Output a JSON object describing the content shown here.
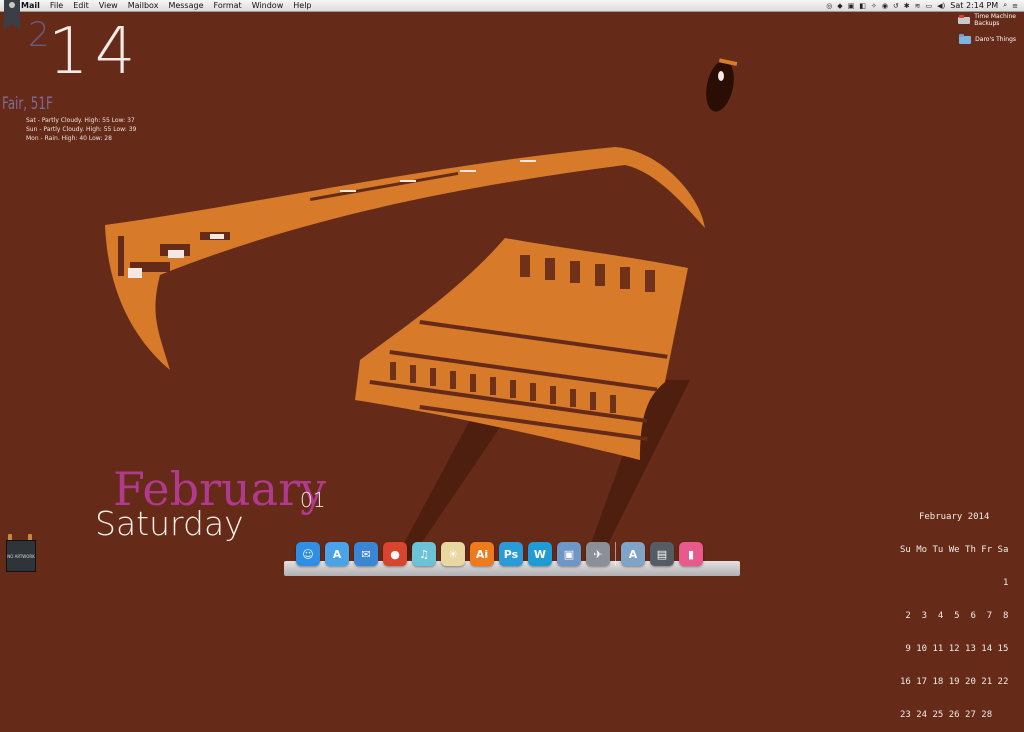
{
  "menubar": {
    "items": [
      "Mail",
      "File",
      "Edit",
      "View",
      "Mailbox",
      "Message",
      "Format",
      "Window",
      "Help"
    ],
    "clock": "Sat 2:14 PM"
  },
  "desktop_clock": {
    "hour_small": "2",
    "minutes": "14"
  },
  "weather": {
    "current": "Fair, 51F",
    "forecast": [
      "Sat - Partly Cloudy. High: 55 Low: 37",
      "Sun - Partly Cloudy. High: 55 Low: 39",
      "Mon - Rain. High: 40 Low: 28"
    ]
  },
  "date_widget": {
    "month": "February",
    "day": "01",
    "weekday": "Saturday"
  },
  "desktop_icons": [
    {
      "label1": "Time Machine",
      "label2": "Backups"
    },
    {
      "label1": "Daro's Things",
      "label2": ""
    }
  ],
  "calendar": {
    "title": "February 2014",
    "header": "Su Mo Tu We Th Fr Sa",
    "rows": [
      "                   1",
      " 2  3  4  5  6  7  8",
      " 9 10 11 12 13 14 15",
      "16 17 18 19 20 21 22",
      "23 24 25 26 27 28"
    ]
  },
  "artwork": {
    "label": "NO ARTWORK"
  },
  "dock": {
    "apps": [
      {
        "name": "Finder",
        "glyph": "☺",
        "color": "#2f8ee6"
      },
      {
        "name": "App Store",
        "glyph": "A",
        "color": "#4aa3e8"
      },
      {
        "name": "Mail",
        "glyph": "✉",
        "color": "#3b86d4"
      },
      {
        "name": "Chrome",
        "glyph": "●",
        "color": "#d9442f"
      },
      {
        "name": "iTunes",
        "glyph": "♫",
        "color": "#6cc2d6"
      },
      {
        "name": "Tips",
        "glyph": "☀",
        "color": "#e9d7a2"
      },
      {
        "name": "Illustrator",
        "glyph": "Ai",
        "color": "#ee7a1c"
      },
      {
        "name": "Photoshop",
        "glyph": "Ps",
        "color": "#2a9ad8"
      },
      {
        "name": "Word",
        "glyph": "W",
        "color": "#1f9bd6"
      },
      {
        "name": "Preview",
        "glyph": "▣",
        "color": "#6e97c8"
      },
      {
        "name": "Launchpad",
        "glyph": "✈",
        "color": "#8a8f98"
      },
      {
        "name": "Applications",
        "glyph": "A",
        "color": "#7fa4c8"
      },
      {
        "name": "Downloads",
        "glyph": "▤",
        "color": "#555c63"
      },
      {
        "name": "Trash",
        "glyph": "▮",
        "color": "#e85a8c"
      }
    ]
  },
  "colors": {
    "wallpaper": "#652a18",
    "artwork_orange": "#d77a2a",
    "month_purple": "#b03a8e"
  }
}
